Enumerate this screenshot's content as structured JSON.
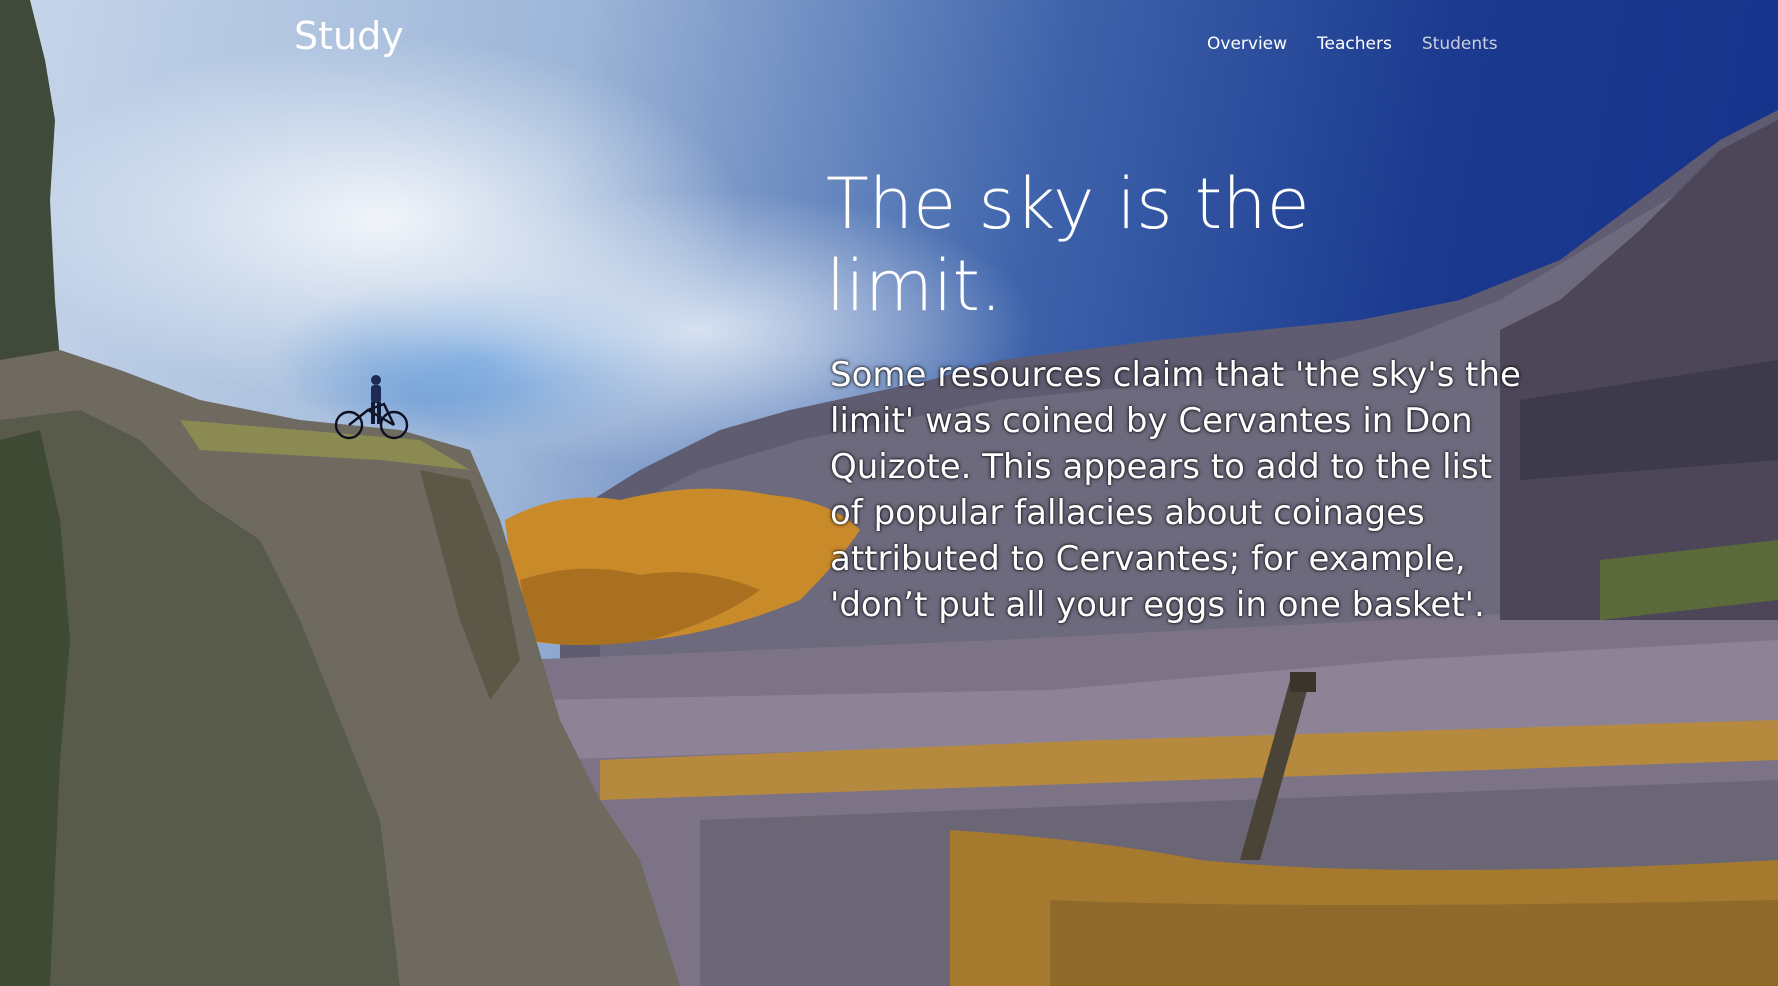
{
  "header": {
    "brand": "Study",
    "nav": [
      {
        "label": "Overview",
        "active": false
      },
      {
        "label": "Teachers",
        "active": false
      },
      {
        "label": "Students",
        "active": true
      }
    ]
  },
  "hero": {
    "headline": "The sky is the limit.",
    "body": "Some resources claim that 'the sky's the limit' was coined by Cervantes in Don Quizote. This appears to add to the list of popular fallacies about coinages attributed to Cervantes; for example, 'don’t put all your eggs in one basket'."
  },
  "colors": {
    "text": "#ffffff",
    "nav_dim": "#c9cfdc",
    "sky_deep": "#15308a"
  }
}
